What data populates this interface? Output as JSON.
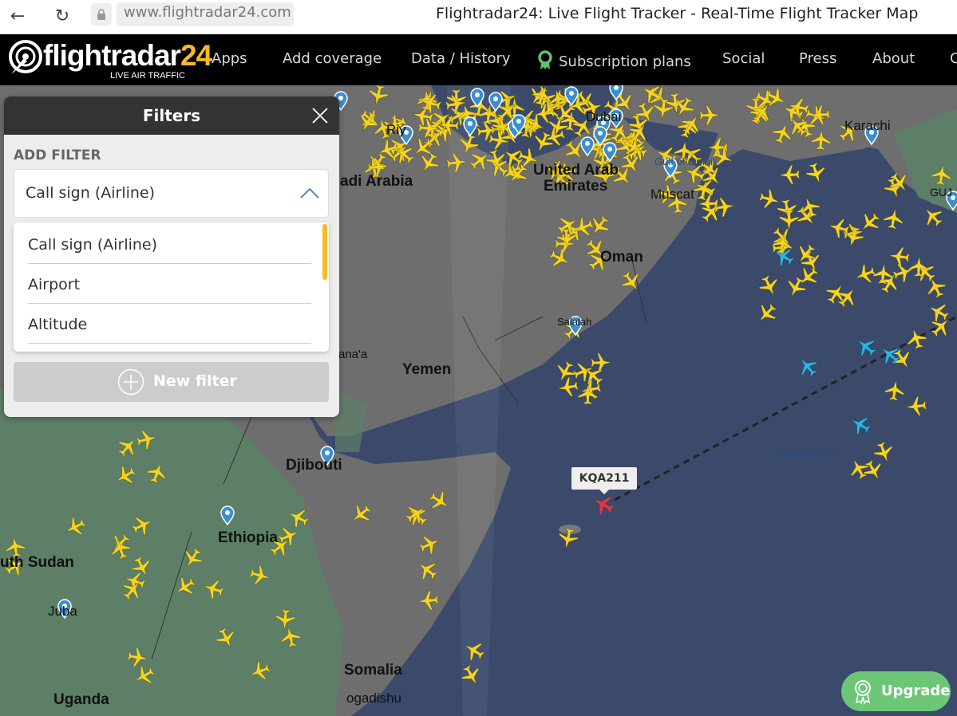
{
  "browser": {
    "url": "www.flightradar24.com",
    "page_title": "Flightradar24: Live Flight Tracker - Real-Time Flight Tracker Map"
  },
  "header": {
    "logo_text": "flightradar",
    "logo_number": "24",
    "logo_tagline": "LIVE AIR TRAFFIC",
    "nav": [
      {
        "label": "Apps"
      },
      {
        "label": "Add coverage"
      },
      {
        "label": "Data / History"
      },
      {
        "label": "Subscription plans",
        "icon": "award-icon"
      },
      {
        "label": "Social"
      },
      {
        "label": "Press"
      },
      {
        "label": "About"
      },
      {
        "label": "C"
      }
    ]
  },
  "filters": {
    "title": "Filters",
    "add_filter_label": "ADD FILTER",
    "selected": "Call sign (Airline)",
    "options": [
      "Call sign (Airline)",
      "Airport",
      "Altitude"
    ],
    "new_filter_label": "New filter"
  },
  "map": {
    "countries": [
      "Yemen",
      "Djibouti",
      "Ethiopia",
      "uth Sudan",
      "Somalia",
      "Uganda",
      "United Arab",
      "Emirates",
      "Oman",
      "adi Arabia"
    ],
    "cities": [
      "Karachi",
      "Salalah",
      "ana'a",
      "Juba",
      "ogadishu",
      "Riy",
      "Dubai",
      "Muscat",
      "GUJ"
    ],
    "seas": [
      "Gulf of Aden",
      "Arabian Sea",
      "Gulf of Oman"
    ],
    "selected_flight": {
      "callsign": "KQA211",
      "color": "#e8343f"
    },
    "colors": {
      "aircraft": "#f5d41f",
      "aircraft_other": "#27b6e6",
      "sea": "#3b4a6b",
      "land": "#6f6f6f",
      "green_land": "#5d7f68",
      "pin": "#3a8fd0"
    }
  },
  "upgrade": {
    "label": "Upgrade"
  }
}
